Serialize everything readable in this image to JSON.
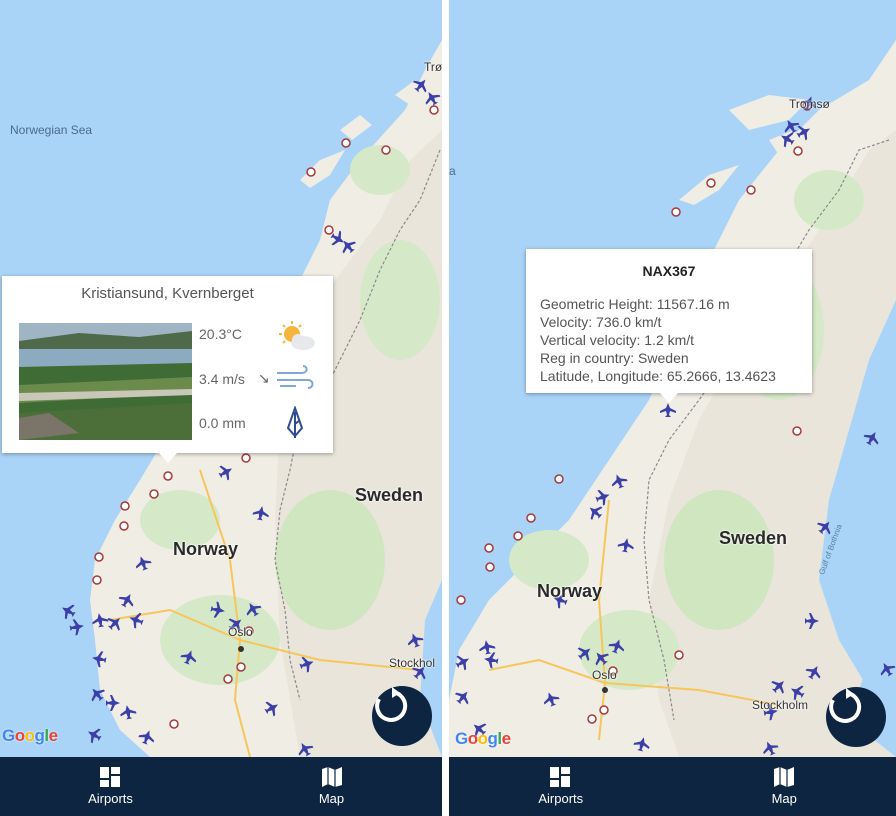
{
  "left_panel": {
    "map_labels": {
      "sea": "Norwegian Sea",
      "norway": "Norway",
      "sweden": "Sweden",
      "oslo": "Oslo",
      "stockholm": "Stockhol",
      "tromso": "Trø"
    },
    "info_window": {
      "title": "Kristiansund, Kvernberget",
      "temperature": "20.3°C",
      "temperature_icon": "partly-sunny-icon",
      "wind": "3.4 m/s",
      "wind_direction_icon": "arrow-southeast-icon",
      "wind_icon": "wind-icon",
      "precipitation": "0.0 mm",
      "precipitation_icon": "closed-umbrella-icon"
    },
    "google_logo": "Google",
    "nav": {
      "airports_label": "Airports",
      "map_label": "Map"
    }
  },
  "right_panel": {
    "map_labels": {
      "sea": "a",
      "norway": "Norway",
      "sweden": "Sweden",
      "oslo": "Oslo",
      "stockholm": "Stockholm",
      "tromso": "Tromsø",
      "gulf": "Gulf of Bothnia"
    },
    "info_window": {
      "callsign": "NAX367",
      "geometric_height": "Geometric Height: 11567.16 m",
      "velocity": "Velocity: 736.0 km/t",
      "vertical_velocity": "Vertical velocity: 1.2 km/t",
      "reg_country": "Reg in country: Sweden",
      "lat_lon": "Latitude, Longitude: 65.2666, 13.4623"
    },
    "google_logo": "Google",
    "nav": {
      "airports_label": "Airports",
      "map_label": "Map"
    }
  },
  "colors": {
    "water": "#a9d4f7",
    "land": "#f0ede4",
    "forest": "#cfe6c1",
    "nav_bg": "#0d2540",
    "plane": "#3c3fa8",
    "airport_marker": "#a33a3a"
  }
}
